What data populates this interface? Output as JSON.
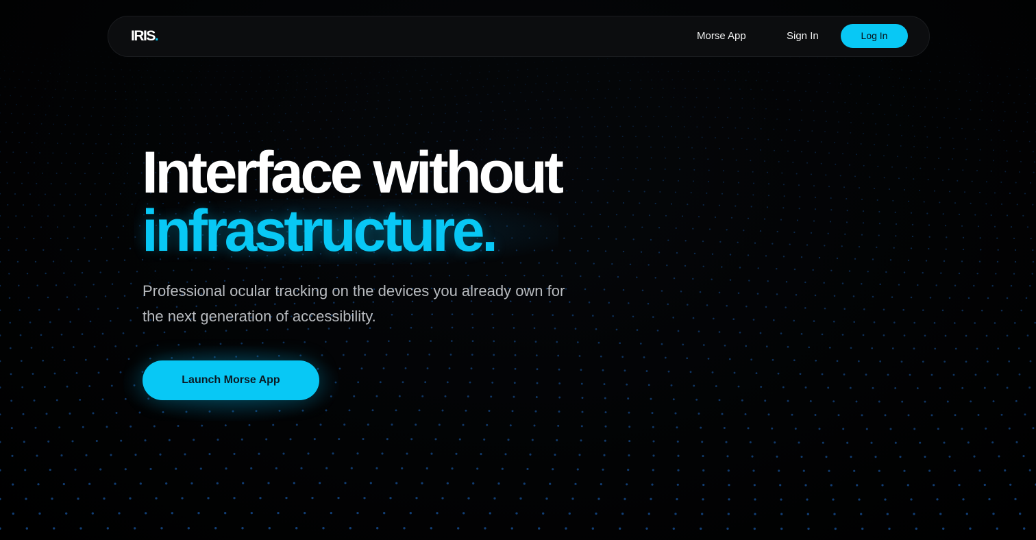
{
  "brand": {
    "name": "IRIS",
    "dot": ".",
    "accent_color": "#08c8f5"
  },
  "nav": {
    "morse_app": "Morse App",
    "sign_in": "Sign In",
    "log_in": "Log In"
  },
  "hero": {
    "headline_line1": "Interface without",
    "headline_line2": "infrastructure.",
    "subtitle": "Professional ocular tracking on the devices you already own for the next generation of accessibility.",
    "cta_label": "Launch Morse App"
  },
  "colors": {
    "background": "#000000",
    "nav_background": "#0c0d0f",
    "accent": "#08c8f5",
    "headline": "#ffffff",
    "subtitle": "#b9bcc0",
    "dots": "#1f6fd0"
  }
}
